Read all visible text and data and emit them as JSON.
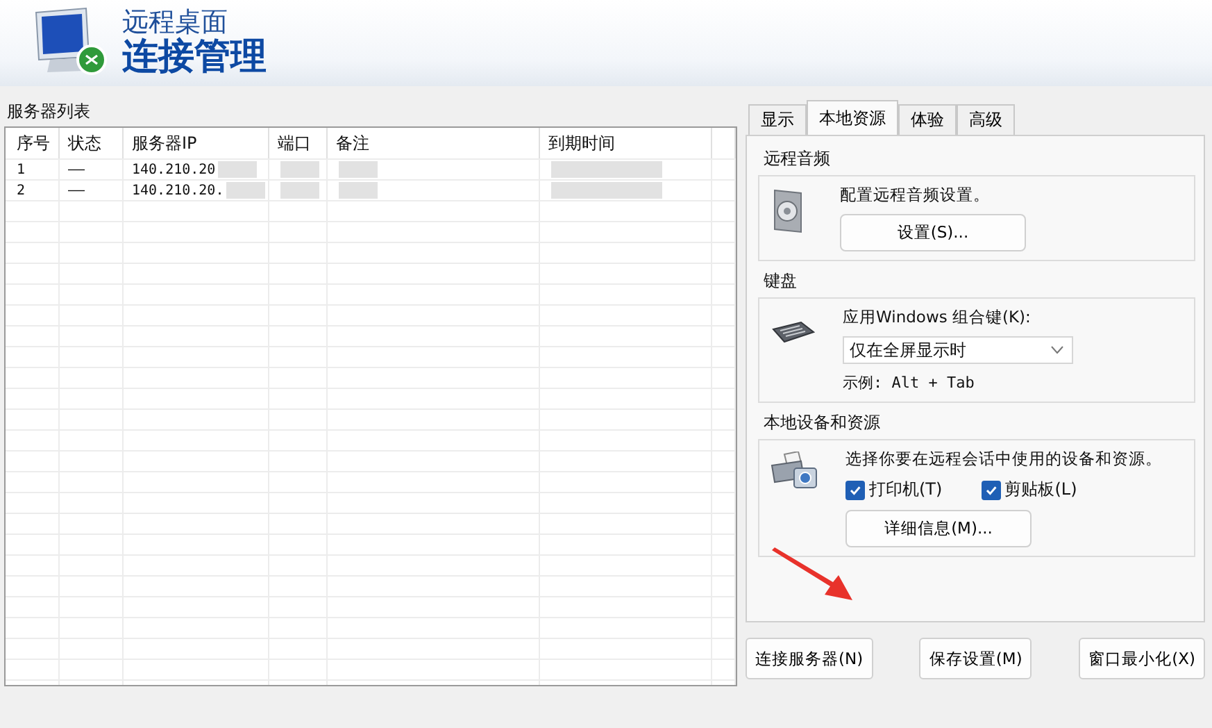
{
  "header": {
    "subtitle": "远程桌面",
    "title": "连接管理"
  },
  "server_list": {
    "label": "服务器列表",
    "columns": [
      "序号",
      "状态",
      "服务器IP",
      "端口",
      "备注",
      "到期时间"
    ],
    "rows": [
      {
        "cells": [
          "1",
          "——",
          "140.210.20",
          "",
          "",
          ""
        ],
        "redacted": [
          false,
          false,
          true,
          true,
          true,
          true
        ]
      },
      {
        "cells": [
          "2",
          "——",
          "140.210.20.",
          "",
          "",
          ""
        ],
        "redacted": [
          false,
          false,
          true,
          true,
          true,
          true
        ]
      }
    ]
  },
  "tabs": [
    {
      "label": "显示",
      "selected": false
    },
    {
      "label": "本地资源",
      "selected": true
    },
    {
      "label": "体验",
      "selected": false
    },
    {
      "label": "高级",
      "selected": false
    }
  ],
  "audio": {
    "title": "远程音频",
    "description": "配置远程音频设置。",
    "button": "设置(S)..."
  },
  "keyboard": {
    "title": "键盘",
    "label": "应用Windows 组合键(K):",
    "value": "仅在全屏显示时",
    "example": "示例: Alt + Tab"
  },
  "devices": {
    "title": "本地设备和资源",
    "description": "选择你要在远程会话中使用的设备和资源。",
    "checkboxes": [
      {
        "label": "打印机(T)",
        "checked": true
      },
      {
        "label": "剪贴板(L)",
        "checked": true
      }
    ],
    "button": "详细信息(M)..."
  },
  "buttons": [
    "连接服务器(N)",
    "保存设置(M)",
    "窗口最小化(X)"
  ]
}
